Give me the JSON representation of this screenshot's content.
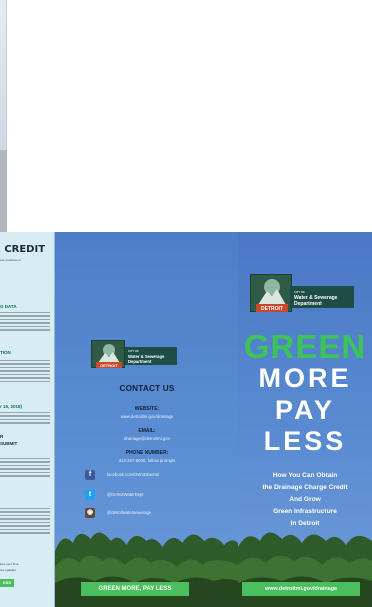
{
  "left_panel": {
    "title": "E CREDIT",
    "subtitle": "ese practices or",
    "sections": [
      {
        "heading": "G DATA",
        "color": "green"
      },
      {
        "heading": "TION",
        "color": "green"
      },
      {
        "heading": "r 15, 2018)",
        "color": "green"
      },
      {
        "heading": "R",
        "color": "dark"
      },
      {
        "heading": "SUBMIT",
        "color": "dark"
      }
    ],
    "footer_lines": [
      "ices over time.",
      "ree updates."
    ],
    "button_label": "ESS"
  },
  "middle_panel": {
    "logo": {
      "emblem_label": "DETROIT",
      "small_text": "CITY OF",
      "org_line1": "Water & Sewerage",
      "org_line2": "Department"
    },
    "contact_title": "CONTACT US",
    "website_label": "WEBSITE:",
    "website_value": "www.detroitmi.gov/drainage",
    "email_label": "EMAIL:",
    "email_value": "drainage@detroitmi.gov",
    "phone_label": "PHONE NUMBER:",
    "phone_value": "313-267-8000, follow prompts",
    "social": [
      {
        "icon": "facebook-icon",
        "glyph": "f",
        "color": "#3b5998",
        "text": "facebook.com/DWSDDetroit"
      },
      {
        "icon": "twitter-icon",
        "glyph": "t",
        "color": "#1da1f2",
        "text": "@DetroitWaterDept"
      },
      {
        "icon": "instagram-icon",
        "glyph": "◉",
        "color": "#5b4a3a",
        "text": "@detroitwatersewerage"
      }
    ],
    "banner": "GREEN MORE, PAY LESS"
  },
  "right_panel": {
    "logo": {
      "emblem_label": "DETROIT",
      "small_text": "CITY OF",
      "org_line1": "Water & Sewerage",
      "org_line2": "Department"
    },
    "hero_green": "GREEN",
    "hero_more": "MORE",
    "hero_pay": "PAY",
    "hero_less": "LESS",
    "sub_lines": [
      "How You Can Obtain",
      "the Drainage Charge Credit",
      "And Grow",
      "Green Infrastructure",
      "In Detroit"
    ],
    "url_banner": "www.detroitmi.gov/drainage"
  },
  "colors": {
    "brand_green": "#4bbf5d",
    "hero_green": "#3cc35a",
    "sky_blue": "#5b8ed3",
    "logo_dark_green": "#1e4d45"
  }
}
